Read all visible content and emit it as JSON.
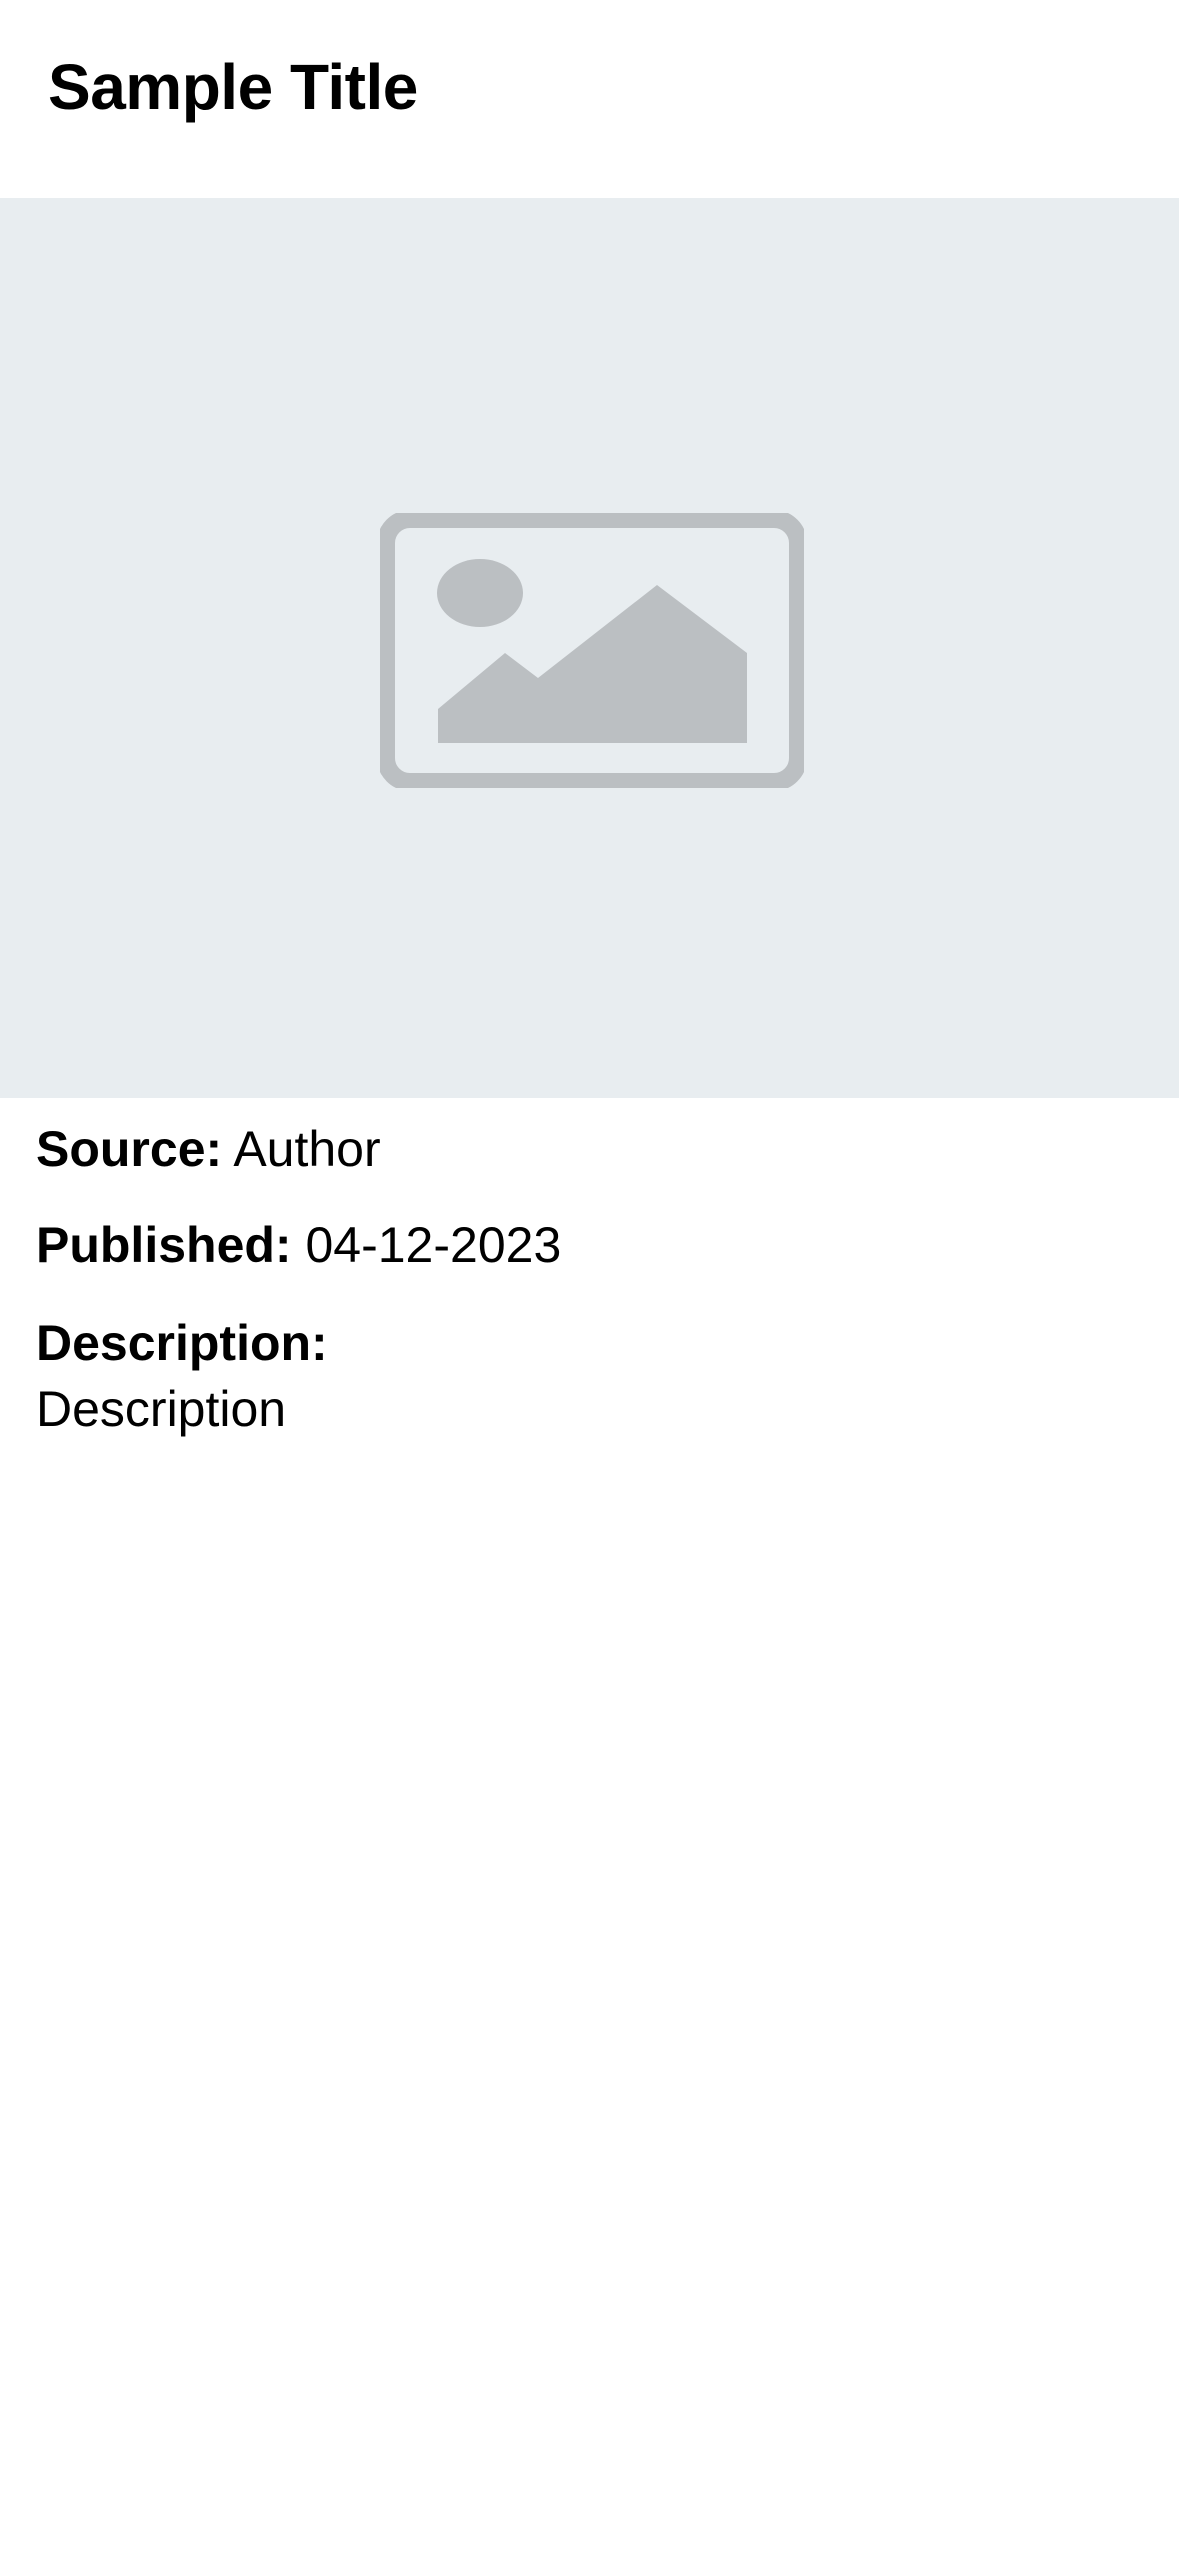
{
  "header": {
    "title": "Sample Title"
  },
  "image": {
    "icon": "image-placeholder-icon",
    "background_color": "#e8edf0",
    "icon_color": "#bbbfc2"
  },
  "details": {
    "source_label": "Source:",
    "source_value": "Author",
    "published_label": "Published:",
    "published_value": "04-12-2023",
    "description_label": "Description:",
    "description_value": "Description"
  }
}
